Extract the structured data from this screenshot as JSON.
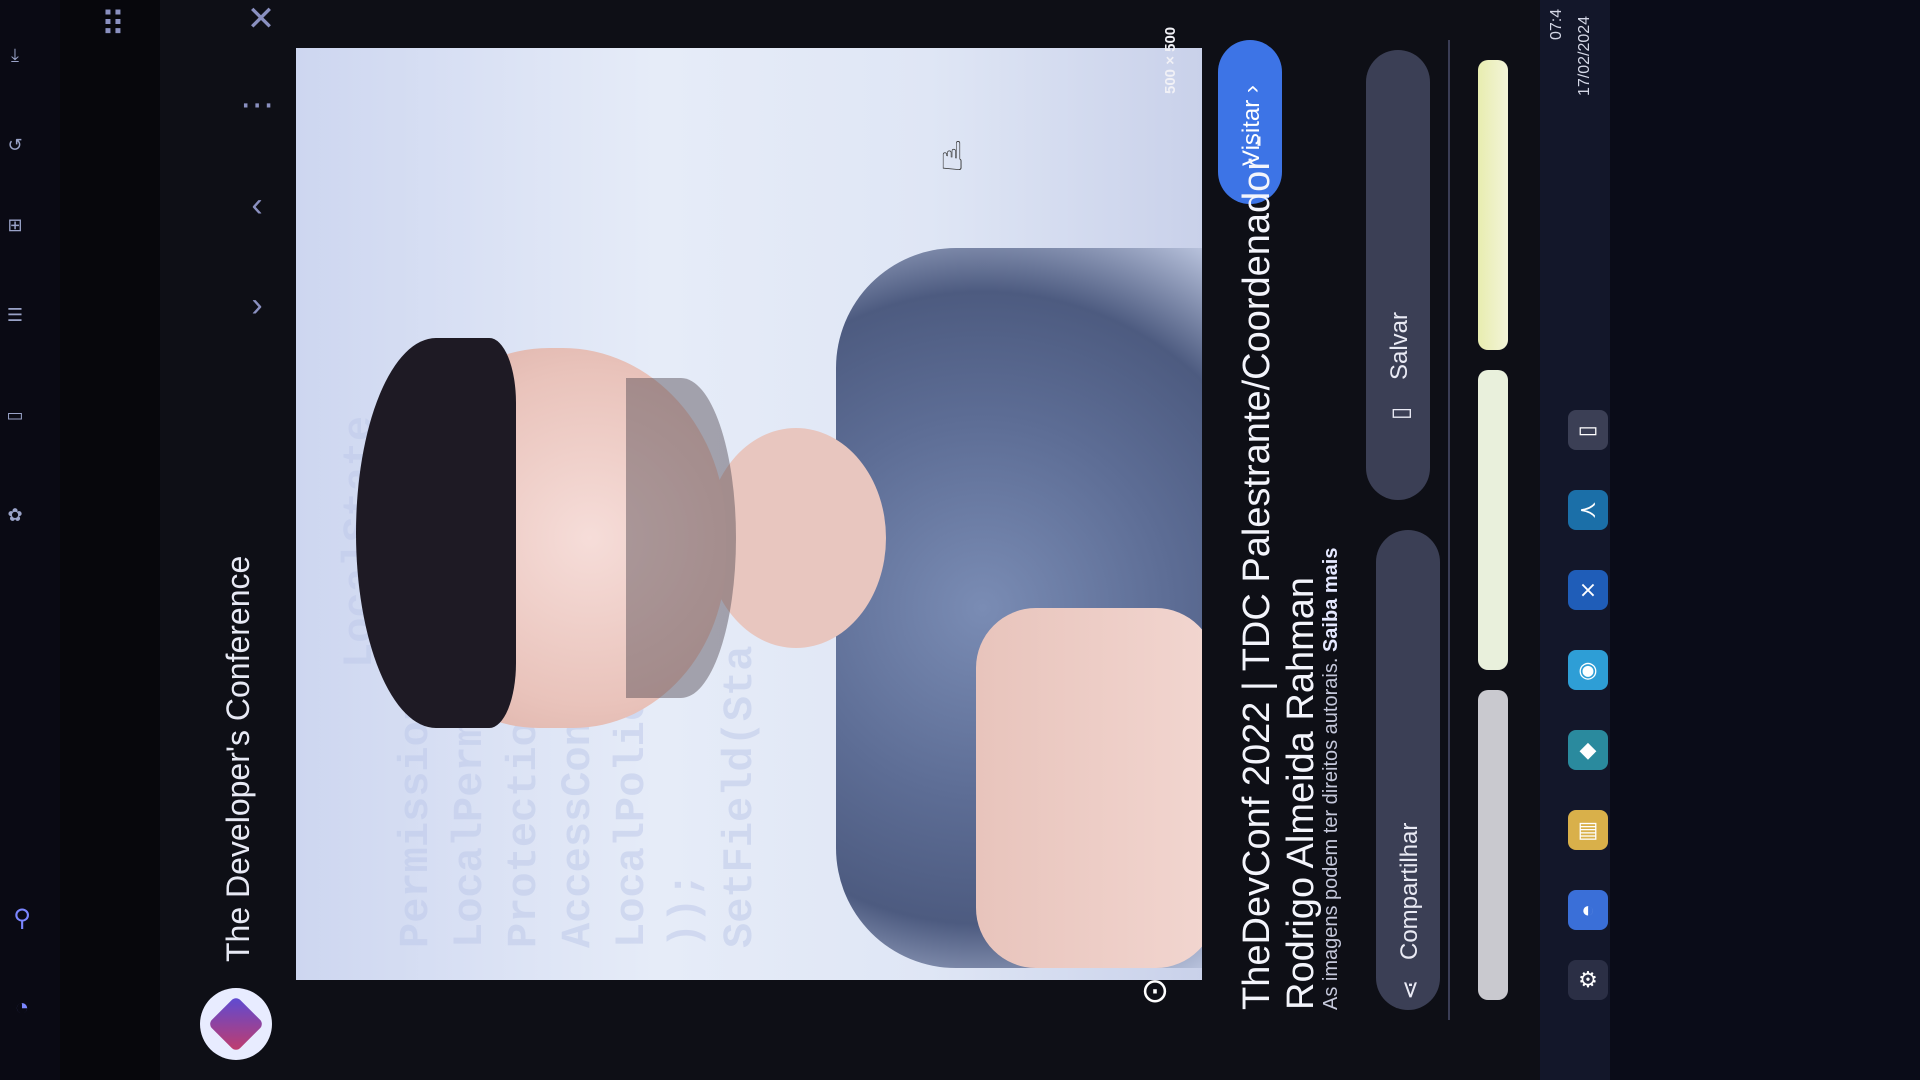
{
  "source": {
    "name": "The Developer's Conference"
  },
  "image": {
    "size_label": "500 × 500",
    "code_lines": [
      "LocalState",
      "Permissions LocalState",
      "LocalPermissions",
      "Protection",
      "AccessControl",
      "LocalPolicy",
      "));",
      "SetField(Sta"
    ]
  },
  "actions": {
    "visit_label": "Visitar ›",
    "save_label": "Salvar",
    "share_label": "Compartilhar"
  },
  "result": {
    "title_line_1": "TheDevConf 2022 | TDC Palestrante/Coordenador -",
    "title_line_2": "Rodrigo Almeida Rahman",
    "copyright_notice": "As imagens podem ter direitos autorais.",
    "learn_more": "Saiba mais"
  },
  "taskbar": {
    "time": "07:4",
    "date": "17/02/2024"
  },
  "colors": {
    "accent": "#3d74e6",
    "panel": "#0e0f16",
    "pill": "#3b3f55"
  },
  "icons": {
    "close": "close-icon",
    "more": "more-options-icon",
    "up": "chevron-up-icon",
    "down": "chevron-down-icon",
    "lens": "google-lens-icon",
    "apps": "apps-grid-icon",
    "search": "search-icon"
  }
}
